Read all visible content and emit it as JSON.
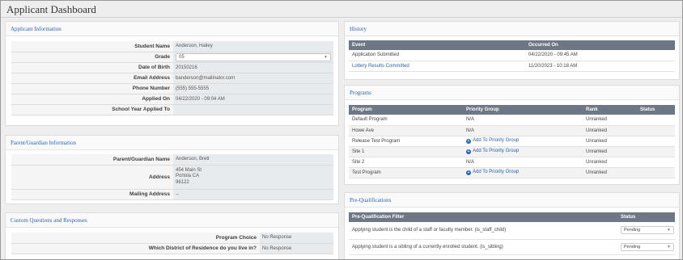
{
  "page_title": "Applicant Dashboard",
  "applicant": {
    "heading": "Applicant Information",
    "rows": [
      {
        "label": "Student Name",
        "value": "Anderson, Hailey"
      },
      {
        "label": "Grade",
        "value": "05"
      },
      {
        "label": "Date of Birth",
        "value": "20150216"
      },
      {
        "label": "Email Address",
        "value": "banderson@mailinator.com"
      },
      {
        "label": "Phone Number",
        "value": "(555) 555-5555"
      },
      {
        "label": "Applied On",
        "value": "04/22/2020 - 09:04 AM"
      },
      {
        "label": "School Year Applied To",
        "value": ""
      }
    ]
  },
  "guardian": {
    "heading": "Parent/Guardian Information",
    "name_label": "Parent/Guardian Name",
    "name_value": "Anderson, Brett",
    "address_label": "Address",
    "address_lines": [
      "454 Main St",
      "Portola CA",
      "96122"
    ],
    "mailing_label": "Mailing Address",
    "mailing_value": "--"
  },
  "custom": {
    "heading": "Custom Questions and Responses",
    "rows": [
      {
        "label": "Program Choice",
        "value": "No Response"
      },
      {
        "label": "Which District of Residence do you live in?",
        "value": "No Response"
      }
    ]
  },
  "history": {
    "heading": "History",
    "col_event": "Event",
    "col_occurred": "Occurred On",
    "rows": [
      {
        "event": "Application Submitted",
        "date": "04/22/2020 - 09:45 AM"
      },
      {
        "event": "Lottery Results Committed",
        "date": "11/20/2023 - 10:18 AM"
      }
    ]
  },
  "programs": {
    "heading": "Programs",
    "col_program": "Program",
    "col_priority": "Priority Group",
    "col_rank": "Rank",
    "col_status": "Status",
    "add_label": "Add To Priority Group",
    "rows": [
      {
        "program": "Default Program",
        "priority": "N/A",
        "rank": "Unranked",
        "status": ""
      },
      {
        "program": "Howe Ave",
        "priority": "N/A",
        "rank": "Unranked",
        "status": ""
      },
      {
        "program": "Release Test Program",
        "priority": "Add To Priority Group",
        "rank": "Unranked",
        "status": ""
      },
      {
        "program": "Site 1",
        "priority": "Add To Priority Group",
        "rank": "Unranked",
        "status": ""
      },
      {
        "program": "Site 2",
        "priority": "N/A",
        "rank": "Unranked",
        "status": ""
      },
      {
        "program": "Test Program",
        "priority": "Add To Priority Group",
        "rank": "Unranked",
        "status": ""
      }
    ]
  },
  "prequal": {
    "heading": "Pre-Qualifications",
    "col_filter": "Pre-Qualification Filter",
    "col_status": "Status",
    "rows": [
      {
        "filter": "Applying student is the child of a staff or faculty member. (is_staff_child)",
        "status": "Pending"
      },
      {
        "filter": "Applying student is a sibling of a currently enrolled student. (is_sibling)",
        "status": "Pending"
      }
    ]
  },
  "colors": {
    "link": "#2b62a8",
    "table_header": "#6e7785"
  }
}
